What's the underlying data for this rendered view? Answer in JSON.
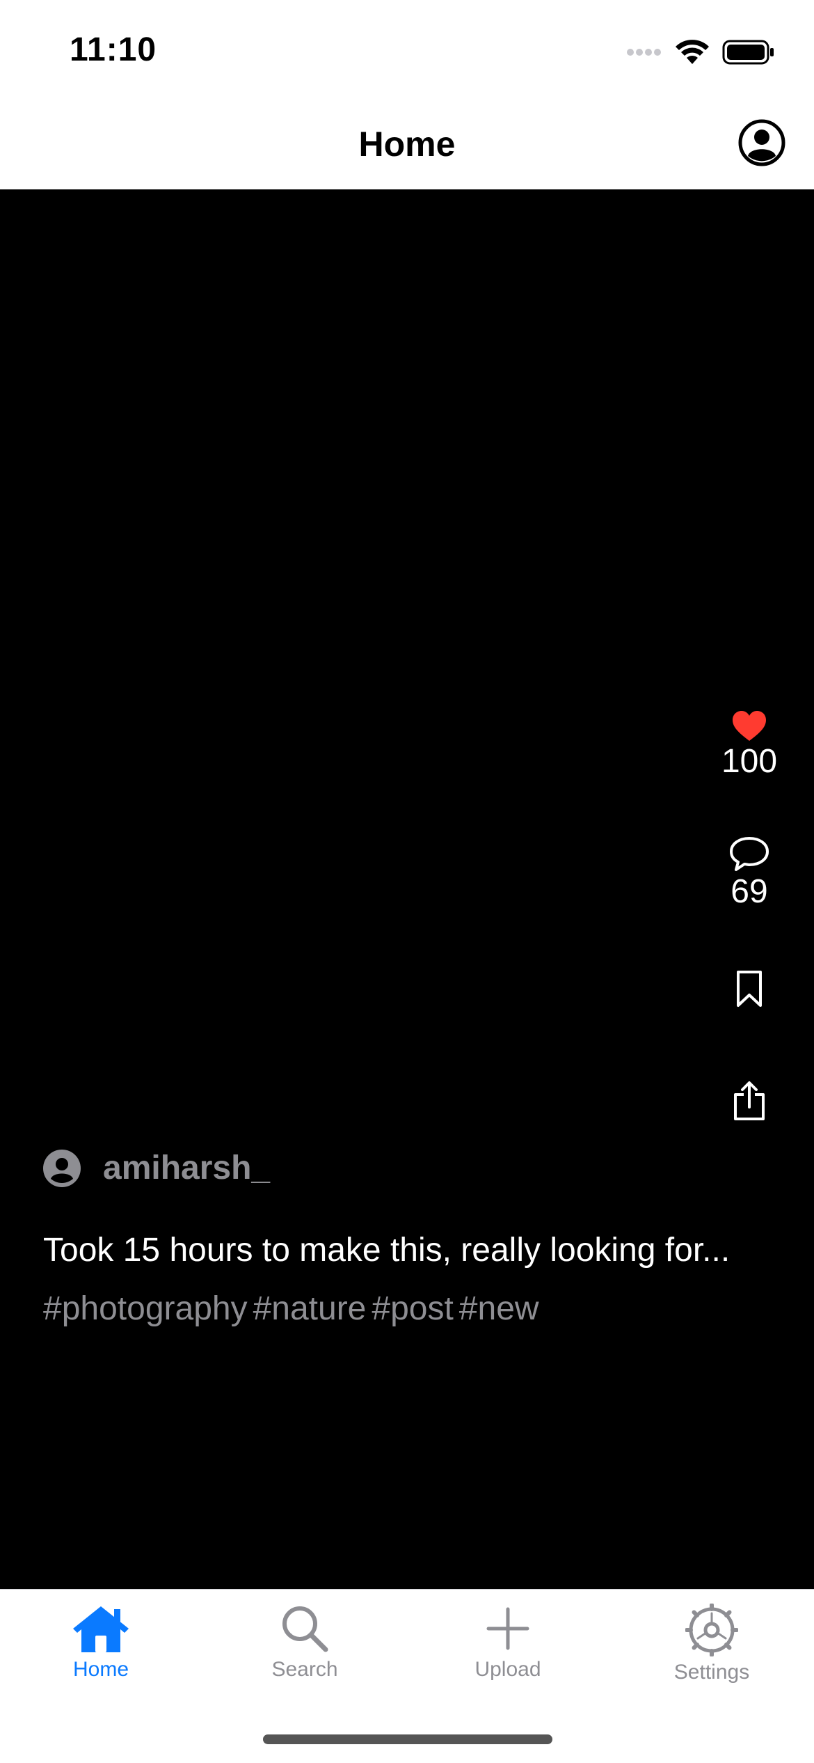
{
  "status_bar": {
    "time": "11:10"
  },
  "nav": {
    "title": "Home"
  },
  "post": {
    "likes": "100",
    "comments": "69",
    "author": "amiharsh_",
    "caption": "Took 15 hours to make this, really looking for...",
    "hashtags": [
      "#photography",
      "#nature",
      "#post",
      "#new"
    ]
  },
  "tabs": [
    {
      "label": "Home",
      "icon": "house-icon",
      "active": true
    },
    {
      "label": "Search",
      "icon": "magnifier-icon",
      "active": false
    },
    {
      "label": "Upload",
      "icon": "plus-icon",
      "active": false
    },
    {
      "label": "Settings",
      "icon": "gear-icon",
      "active": false
    }
  ],
  "colors": {
    "accent": "#0a7aff",
    "like": "#ff3b30",
    "muted": "#8e8e93",
    "feed_bg": "#000000"
  }
}
